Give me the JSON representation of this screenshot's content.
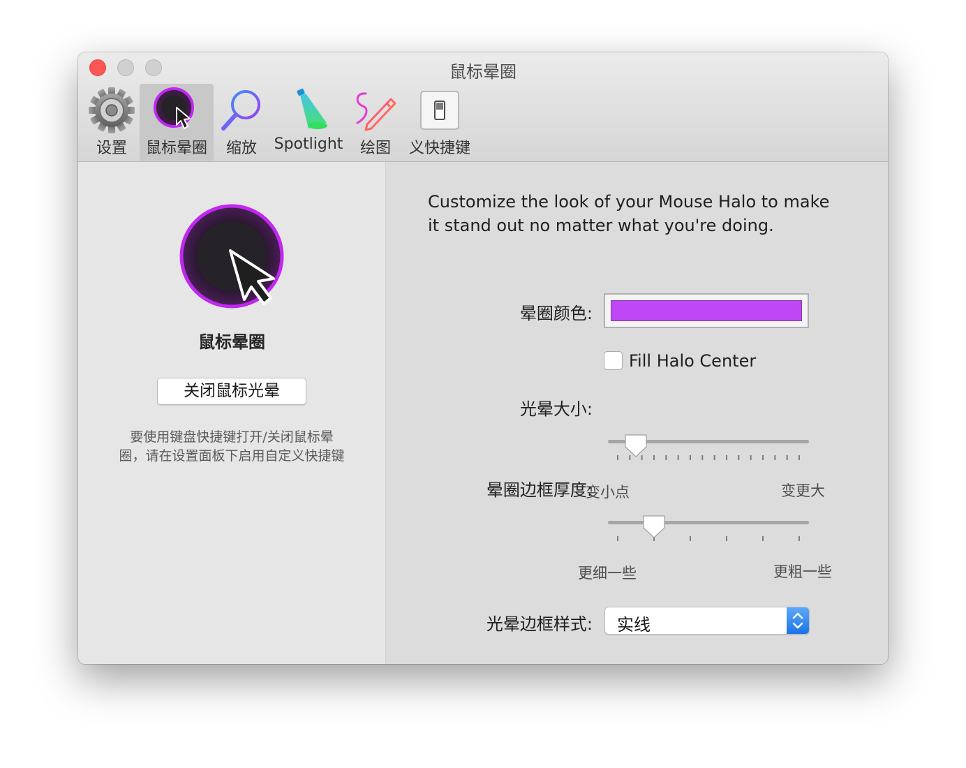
{
  "window": {
    "title": "鼠标晕圈"
  },
  "toolbar": {
    "items": [
      {
        "label": "设置",
        "icon": "gear-icon",
        "selected": false
      },
      {
        "label": "鼠标晕圈",
        "icon": "mouse-halo-icon",
        "selected": true
      },
      {
        "label": "缩放",
        "icon": "magnifier-icon",
        "selected": false
      },
      {
        "label": "Spotlight",
        "icon": "spotlight-icon",
        "selected": false
      },
      {
        "label": "绘图",
        "icon": "pencil-icon",
        "selected": false
      },
      {
        "label": "义快捷键",
        "icon": "switch-icon",
        "selected": false
      }
    ]
  },
  "left_pane": {
    "title": "鼠标晕圈",
    "toggle_button": "关闭鼠标光晕",
    "hint_line1": "要使用键盘快捷键打开/关闭鼠标晕",
    "hint_line2": "圈，请在设置面板下启用自定义快捷键"
  },
  "right_pane": {
    "description_line1": "Customize the look of your Mouse Halo to make",
    "description_line2": "it stand out no matter what you're doing.",
    "halo_color": {
      "label": "晕圈颜色:",
      "value": "#c047f5"
    },
    "fill_center": {
      "label": "Fill Halo Center",
      "checked": false
    },
    "halo_size": {
      "label": "光晕大小:",
      "min_label": "变小点",
      "max_label": "变更大",
      "value": 0.1,
      "tick_count": 16
    },
    "border_thickness": {
      "label": "晕圈边框厚度:",
      "min_label": "更细一些",
      "max_label": "更粗一些",
      "value": 0.2,
      "tick_count": 6
    },
    "border_style": {
      "label": "光晕边框样式:",
      "value": "实线"
    }
  },
  "colors": {
    "accent_purple": "#c047f5",
    "close_red": "#fc5753",
    "popup_blue": "#1a73e8"
  }
}
